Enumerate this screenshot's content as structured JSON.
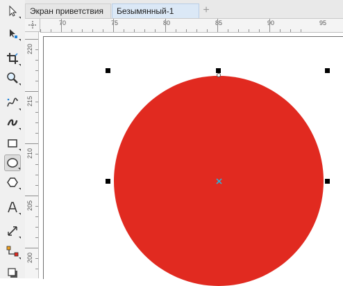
{
  "tabs": [
    {
      "label": "Экран приветствия"
    },
    {
      "label": "Безымянный-1"
    }
  ],
  "add_tab_label": "+",
  "ruler": {
    "horizontal_labels": [
      "70",
      "75",
      "80",
      "85",
      "90",
      "95"
    ],
    "vertical_labels": [
      "220",
      "215",
      "210",
      "205",
      "200"
    ]
  },
  "shape": {
    "type": "ellipse",
    "fill_color": "#e12a20",
    "selected": true
  },
  "toolbox": {
    "active_tool": "ellipse-tool",
    "tools": [
      "pick-tool",
      "shape-tool",
      "crop-tool",
      "zoom-tool",
      "freehand-tool",
      "artistic-media-tool",
      "rectangle-tool",
      "ellipse-tool",
      "polygon-tool",
      "text-tool",
      "parallel-dimension-tool",
      "connector-tool",
      "drop-shadow-tool"
    ]
  }
}
